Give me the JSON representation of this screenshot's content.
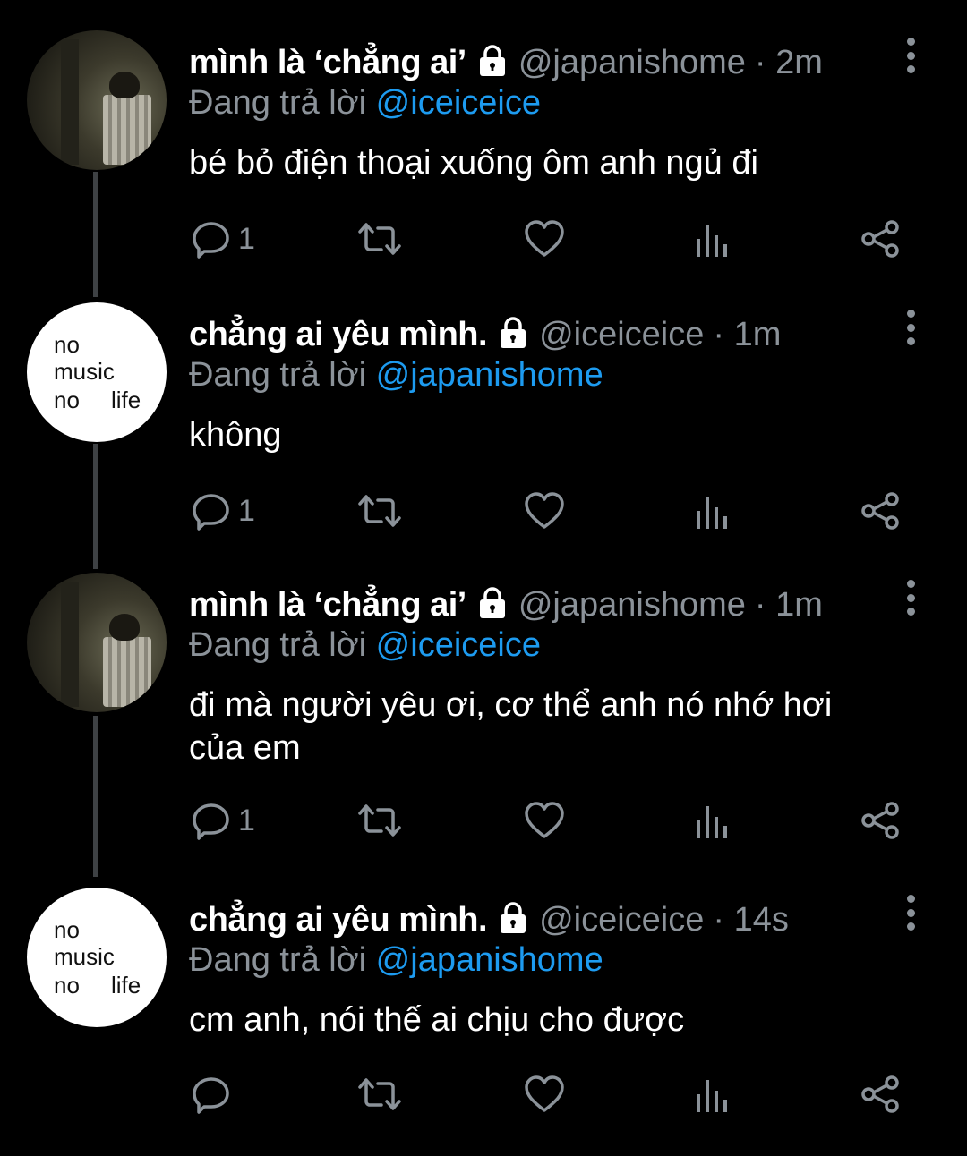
{
  "tweets": [
    {
      "display_name": "mình là ‘chẳng ai’",
      "handle": "@japanishome",
      "time": "· 2m",
      "replying_prefix": "Đang trả lời",
      "replying_to": "@iceiceice",
      "text": "bé bỏ điện thoại xuống ôm anh ngủ đi",
      "reply_count": "1",
      "avatar": "photo"
    },
    {
      "display_name": "chẳng ai yêu mình.",
      "handle": "@iceiceice",
      "time": "· 1m",
      "replying_prefix": "Đang trả lời",
      "replying_to": "@japanishome",
      "text": "không",
      "reply_count": "1",
      "avatar": "text",
      "avatar_lines": [
        "no",
        "music",
        "no",
        "life"
      ]
    },
    {
      "display_name": "mình là ‘chẳng ai’",
      "handle": "@japanishome",
      "time": "· 1m",
      "replying_prefix": "Đang trả lời",
      "replying_to": "@iceiceice",
      "text": "đi mà người yêu ơi, cơ thể anh nó nhớ hơi của em",
      "reply_count": "1",
      "avatar": "photo"
    },
    {
      "display_name": "chẳng ai yêu mình.",
      "handle": "@iceiceice",
      "time": "· 14s",
      "replying_prefix": "Đang trả lời",
      "replying_to": "@japanishome",
      "text": "cm anh, nói thế ai chịu cho được",
      "reply_count": "",
      "avatar": "text",
      "avatar_lines": [
        "no",
        "music",
        "no",
        "life"
      ]
    }
  ],
  "icons": {
    "protected": "lock-icon",
    "more": "more-vertical-icon",
    "reply": "reply-icon",
    "retweet": "retweet-icon",
    "like": "heart-icon",
    "views": "analytics-icon",
    "share": "share-icon"
  },
  "colors": {
    "background": "#000000",
    "text": "#ffffff",
    "secondary": "#8b9299",
    "accent": "#1d9bf0",
    "thread_line": "#3e4144"
  }
}
